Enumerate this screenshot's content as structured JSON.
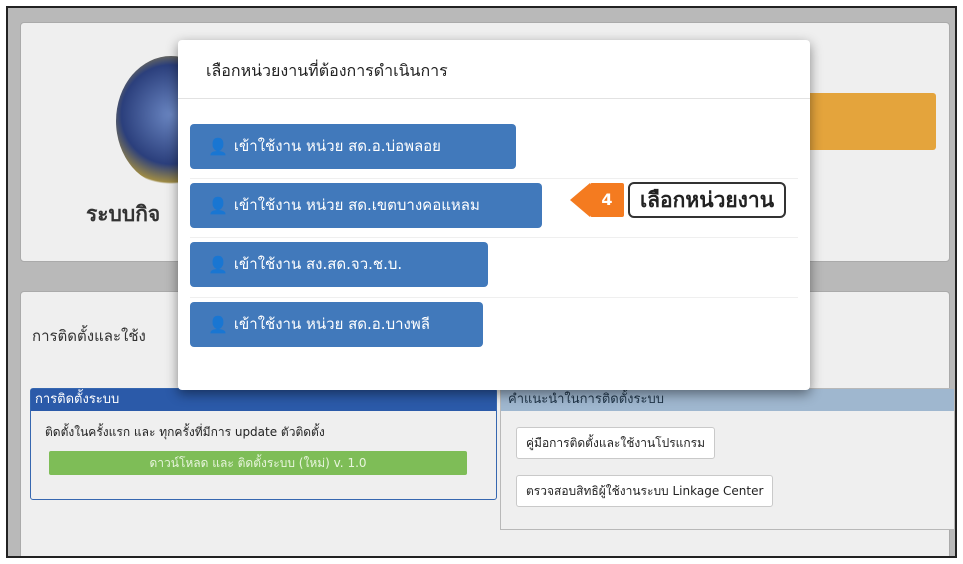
{
  "background": {
    "system_title": "ระบบกิจ",
    "section_title": "การติดตั้งและใช้ง",
    "install_box": {
      "header": "การติดตั้งระบบ",
      "description": "ติดตั้งในครั้งแรก และ ทุกครั้งที่มีการ update ตัวติดตั้ง",
      "download_button": "ดาวน์โหลด และ ติดตั้งระบบ (ใหม่) v. 1.0"
    },
    "advice_box": {
      "header": "คำแนะนำในการติดตั้งระบบ",
      "manual_button": "คู่มือการติดตั้งและใช้งานโปรแกรม",
      "rights_button": "ตรวจสอบสิทธิผู้ใช้งานระบบ Linkage Center"
    }
  },
  "modal": {
    "title": "เลือกหน่วยงานที่ต้องการดำเนินการ",
    "units": [
      {
        "label": "เข้าใช้งาน หน่วย สด.อ.บ่อพลอย",
        "icon": "user-icon"
      },
      {
        "label": "เข้าใช้งาน หน่วย สด.เขตบางคอแหลม",
        "icon": "user-icon"
      },
      {
        "label": "เข้าใช้งาน สง.สด.จว.ช.บ.",
        "icon": "user-icon"
      },
      {
        "label": "เข้าใช้งาน หน่วย สด.อ.บางพลี",
        "icon": "user-icon"
      }
    ]
  },
  "callout": {
    "step": "4",
    "text": "เลือกหน่วยงาน"
  },
  "colors": {
    "primary_button": "#4179bb",
    "callout_orange": "#f47b20",
    "download_green": "#7ebd57"
  }
}
